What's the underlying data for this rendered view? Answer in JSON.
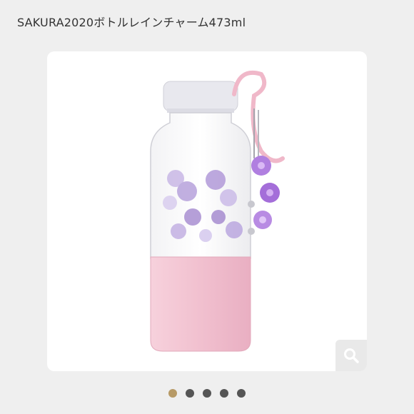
{
  "product": {
    "title": "SAKURA2020ボトルレインチャーム473ml"
  },
  "zoom_button": {
    "icon": "search-icon",
    "color": "#ffffff"
  },
  "carousel": {
    "active_index": 0,
    "active_color": "#b79a66",
    "inactive_color": "#555555",
    "slides": 5
  },
  "colors": {
    "background": "#efefef",
    "card": "#ffffff",
    "bottle_sleeve": "#f3c6d4",
    "cap": "#e8e8ee",
    "blossom": "#b9a6d9"
  }
}
